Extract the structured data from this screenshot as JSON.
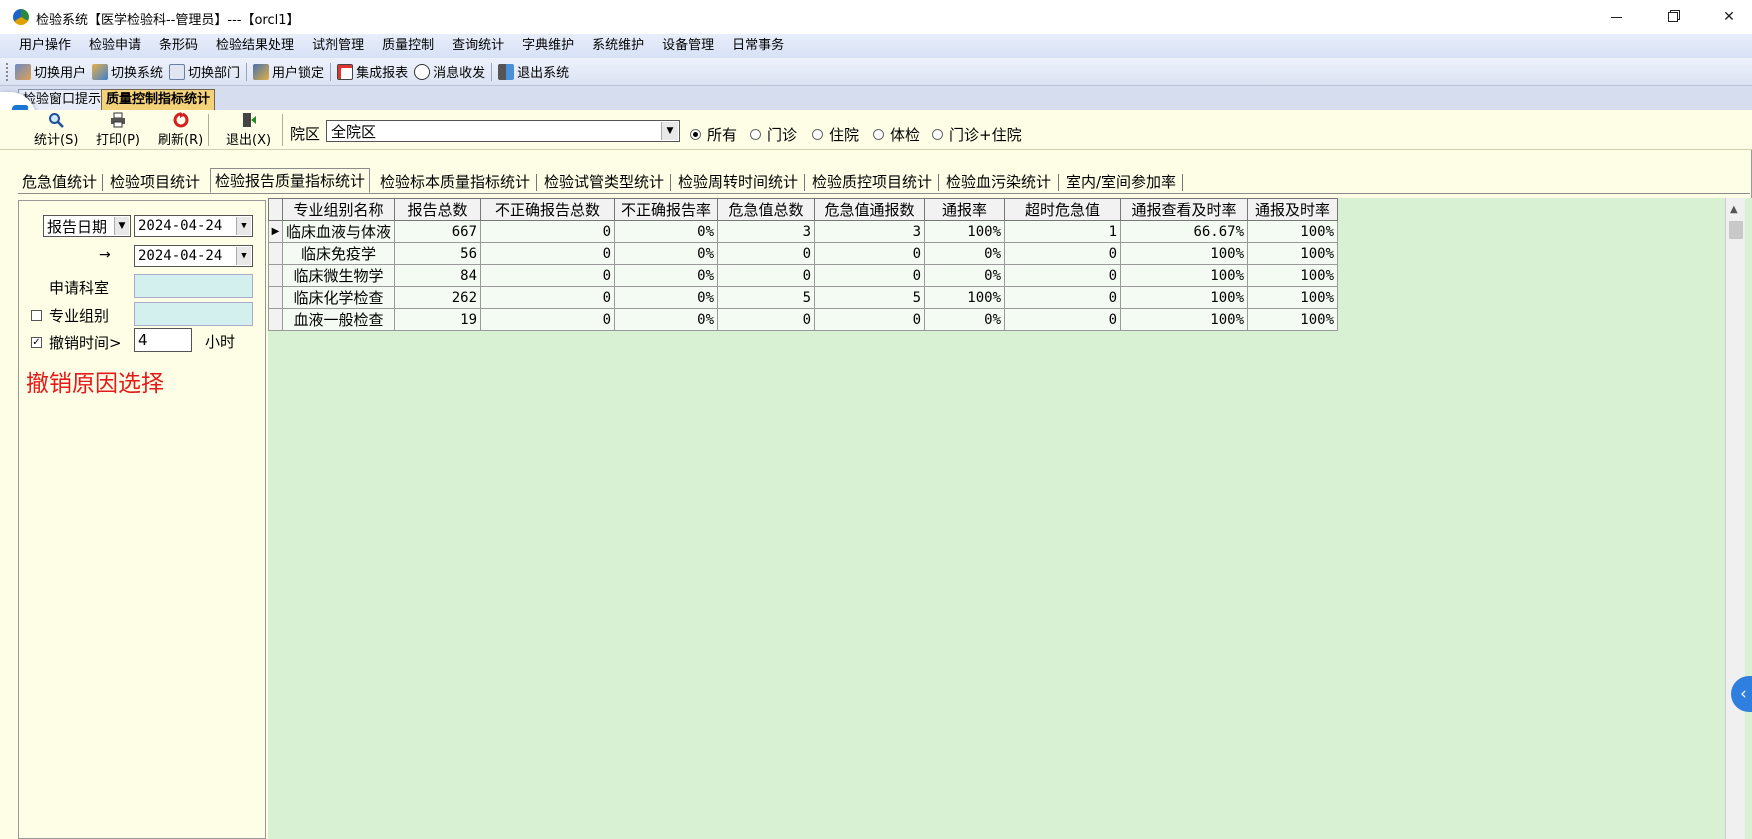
{
  "window": {
    "title": "检验系统【医学检验科--管理员】---【orcl1】",
    "min_glyph": "",
    "close_glyph": "✕"
  },
  "menubar": [
    "用户操作",
    "检验申请",
    "条形码",
    "检验结果处理",
    "试剂管理",
    "质量控制",
    "查询统计",
    "字典维护",
    "系统维护",
    "设备管理",
    "日常事务"
  ],
  "toolbar": {
    "switch_user": "切换用户",
    "switch_system": "切换系统",
    "switch_dept": "切换部门",
    "lock_user": "用户锁定",
    "integrated_report": "集成报表",
    "messages": "消息收发",
    "exit_system": "退出系统"
  },
  "doc_tabs": {
    "hint": "检验窗口提示",
    "qc": "质量控制指标统计"
  },
  "actions": {
    "stat": "统计(S)",
    "print": "打印(P)",
    "refresh": "刷新(R)",
    "exit": "退出(X)"
  },
  "filters": {
    "area_label": "院区",
    "area_value": "全院区",
    "patient_types": [
      "所有",
      "门诊",
      "住院",
      "体检",
      "门诊+住院"
    ],
    "selected_patient_type": "所有"
  },
  "stat_tabs": [
    "危急值统计",
    "检验项目统计",
    "检验报告质量指标统计",
    "检验标本质量指标统计",
    "检验试管类型统计",
    "检验周转时间统计",
    "检验质控项目统计",
    "检验血污染统计",
    "室内/室间参加率"
  ],
  "active_stat_tab": "检验报告质量指标统计",
  "left_panel": {
    "date_type": "报告日期",
    "date_from": "2024-04-24",
    "arrow": "→",
    "date_to": "2024-04-24",
    "dept_label": "申请科室",
    "group_label": "专业组别",
    "group_checked": false,
    "cancel_label": "撤销时间>",
    "cancel_checked": true,
    "cancel_hours": "4",
    "hours_unit": "小时",
    "cancel_reason": "撤销原因选择"
  },
  "grid": {
    "columns": [
      "专业组别名称",
      "报告总数",
      "不正确报告总数",
      "不正确报告率",
      "危急值总数",
      "危急值通报数",
      "通报率",
      "超时危急值",
      "通报查看及时率",
      "通报及时率"
    ],
    "rows": [
      [
        "临床血液与体液",
        "667",
        "0",
        "0%",
        "3",
        "3",
        "100%",
        "1",
        "66.67%",
        "100%"
      ],
      [
        "临床免疫学",
        "56",
        "0",
        "0%",
        "0",
        "0",
        "0%",
        "0",
        "100%",
        "100%"
      ],
      [
        "临床微生物学",
        "84",
        "0",
        "0%",
        "0",
        "0",
        "0%",
        "0",
        "100%",
        "100%"
      ],
      [
        "临床化学检查",
        "262",
        "0",
        "0%",
        "5",
        "5",
        "100%",
        "0",
        "100%",
        "100%"
      ],
      [
        "血液一般检查",
        "19",
        "0",
        "0%",
        "0",
        "0",
        "0%",
        "0",
        "100%",
        "100%"
      ]
    ]
  },
  "colors": {
    "grid_bg": "#d8f1d2",
    "panel_bg": "#fefee6",
    "active_doc_tab": "#f4d27a",
    "cancel_reason": "#e41a1a"
  }
}
